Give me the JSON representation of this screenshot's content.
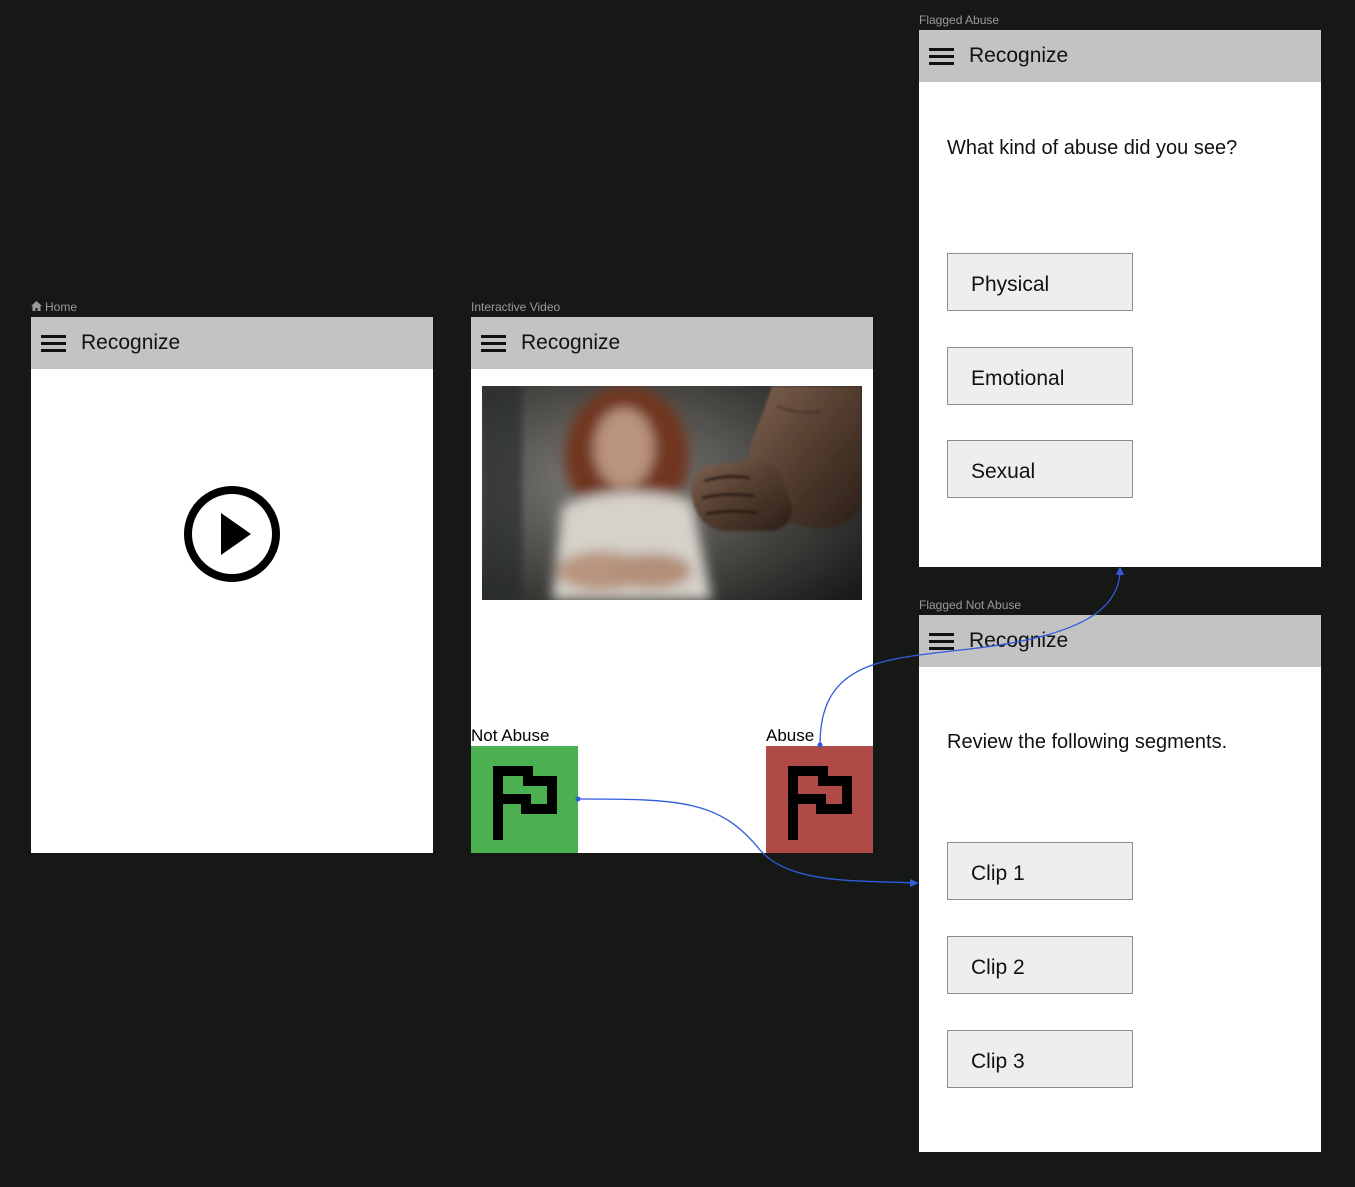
{
  "frames": {
    "flagged_abuse": {
      "label": "Flagged Abuse",
      "app_title": "Recognize",
      "question": "What kind of abuse did you see?",
      "options": [
        "Physical",
        "Emotional",
        "Sexual"
      ]
    },
    "home": {
      "label": "Home",
      "label_icon": "home-icon",
      "app_title": "Recognize",
      "play_icon": "play-circle-icon"
    },
    "interactive_video": {
      "label": "Interactive Video",
      "app_title": "Recognize",
      "video_icon": "video-thumbnail",
      "not_abuse_label": "Not Abuse",
      "abuse_label": "Abuse",
      "flag_icon": "flag-icon"
    },
    "flagged_not_abuse": {
      "label": "Flagged Not Abuse",
      "app_title": "Recognize",
      "question": "Review the following segments.",
      "options": [
        "Clip 1",
        "Clip 2",
        "Clip 3"
      ]
    }
  },
  "colors": {
    "canvas_background": "#161816",
    "appbar": "#c3c3c3",
    "not_abuse_button": "#4caf50",
    "abuse_button": "#b04a47",
    "connector": "#2f5bdc",
    "option_button": "#eeeeee"
  }
}
